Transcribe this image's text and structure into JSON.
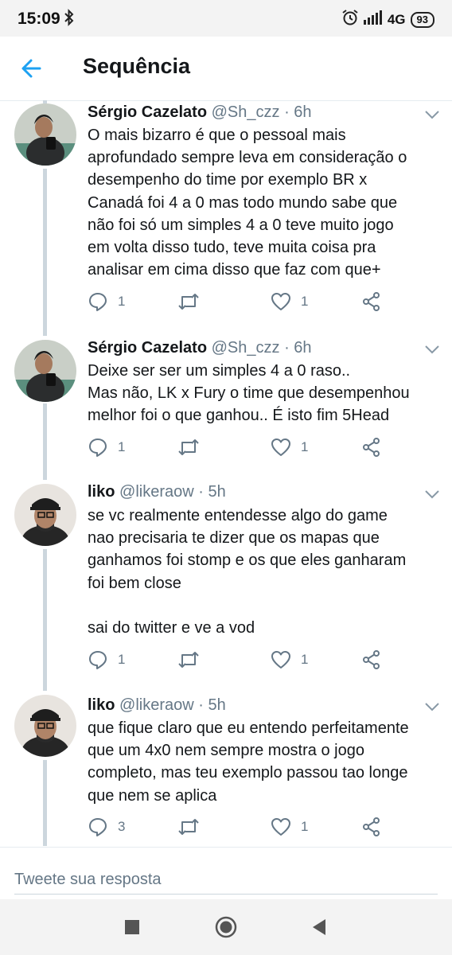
{
  "status_bar": {
    "time": "15:09",
    "network": "4G",
    "battery": "93"
  },
  "header": {
    "title": "Sequência"
  },
  "tweets": [
    {
      "author": "Sérgio Cazelato",
      "handle": "@Sh_czz",
      "separator": "·",
      "time": "6h",
      "text": "O mais bizarro é que o pessoal mais\naprofundado sempre leva em consideração o\ndesempenho do time por exemplo BR x\nCanadá foi 4 a 0 mas todo mundo sabe que\nnão foi só um simples 4 a 0 teve muito jogo\nem volta disso tudo, teve muita coisa pra\nanalisar em cima disso que faz com que+",
      "replies": "1",
      "likes": "1"
    },
    {
      "author": "Sérgio Cazelato",
      "handle": "@Sh_czz",
      "separator": "·",
      "time": "6h",
      "text": "Deixe ser ser um simples 4 a 0 raso..\nMas não, LK x Fury o time que desempenhou\nmelhor foi o que ganhou.. É isto fim 5Head",
      "replies": "1",
      "likes": "1"
    },
    {
      "author": "liko",
      "handle": "@likeraow",
      "separator": "·",
      "time": "5h",
      "text": "se vc realmente entendesse algo do game\nnao precisaria te dizer que os mapas que\nganhamos foi stomp e os que eles ganharam\nfoi bem close\n\nsai do twitter e ve a vod",
      "replies": "1",
      "likes": "1"
    },
    {
      "author": "liko",
      "handle": "@likeraow",
      "separator": "·",
      "time": "5h",
      "text": "que fique claro que eu entendo perfeitamente\nque um 4x0 nem sempre mostra o jogo\ncompleto, mas teu exemplo passou tao longe\nque nem se aplica",
      "replies": "3",
      "likes": "1"
    }
  ],
  "reply_box": {
    "placeholder": "Tweete sua resposta"
  },
  "colors": {
    "accent": "#1da1f2",
    "secondary_text": "#657786",
    "thread_line": "#ccd6dd"
  }
}
